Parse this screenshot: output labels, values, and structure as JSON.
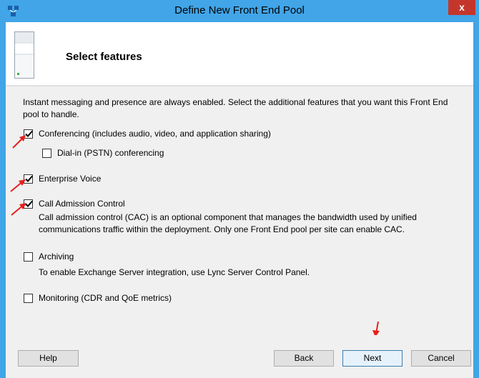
{
  "window": {
    "title": "Define New Front End Pool",
    "close_glyph": "x"
  },
  "header": {
    "title": "Select features"
  },
  "intro": "Instant messaging and presence are always enabled.  Select the additional features that you want this Front End pool to handle.",
  "features": [
    {
      "label": "Conferencing (includes audio, video, and application sharing)",
      "checked": true
    },
    {
      "label": "Dial-in (PSTN) conferencing",
      "checked": false
    },
    {
      "label": "Enterprise Voice",
      "checked": true
    },
    {
      "label": "Call Admission Control",
      "checked": true,
      "description": "Call admission control (CAC) is an optional component that manages the bandwidth used by unified communications traffic within the deployment. Only one Front End pool per site can enable CAC."
    },
    {
      "label": "Archiving",
      "checked": false,
      "description": "To enable Exchange Server integration, use Lync Server Control Panel."
    },
    {
      "label": "Monitoring (CDR and QoE metrics)",
      "checked": false
    }
  ],
  "buttons": {
    "help": "Help",
    "back": "Back",
    "next": "Next",
    "cancel": "Cancel"
  },
  "colors": {
    "frame": "#41a5e8",
    "close": "#c4362b",
    "arrow": "#e8201c"
  }
}
